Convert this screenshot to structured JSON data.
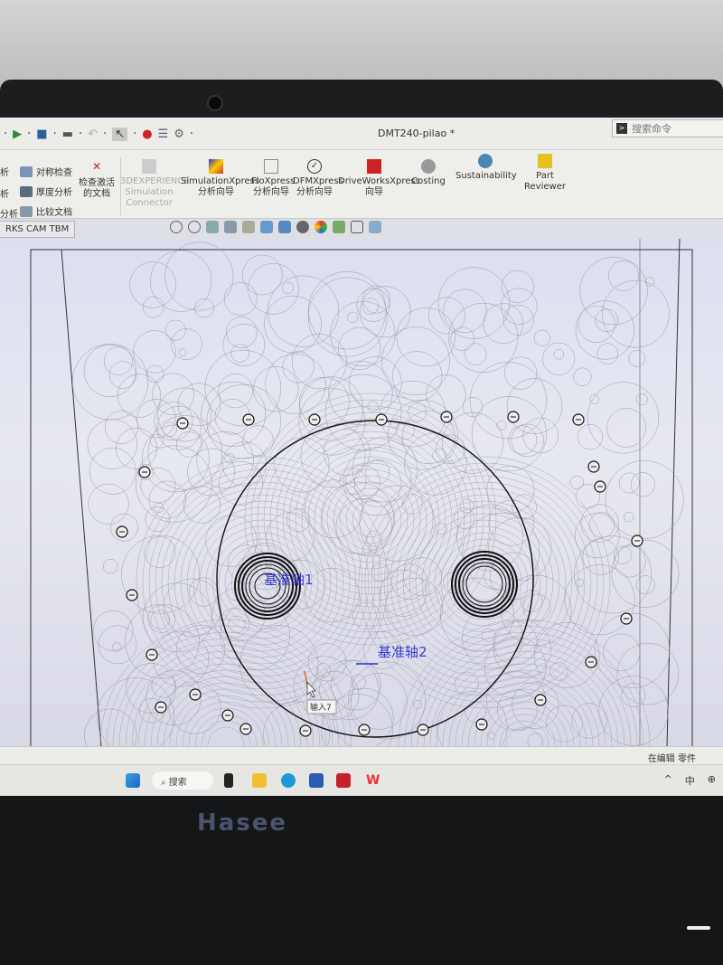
{
  "window": {
    "title": "DMT240-pilao *",
    "search_placeholder": "搜索命令"
  },
  "ribbon": {
    "left_cut": [
      "析",
      "析",
      "分析"
    ],
    "small": [
      "对称检查",
      "厚度分析",
      "比较文档"
    ],
    "check": "检查激活的文档",
    "buttons": [
      {
        "label": "3DEXPERIENCE Simulation Connector",
        "disabled": true
      },
      {
        "label": "SimulationXpress 分析向导"
      },
      {
        "label": "FloXpress 分析向导"
      },
      {
        "label": "DFMXpress 分析向导"
      },
      {
        "label": "DriveWorksXpress 向导"
      },
      {
        "label": "Costing"
      },
      {
        "label": "Sustainability"
      },
      {
        "label": "Part Reviewer"
      }
    ]
  },
  "tab": "RKS CAM TBM",
  "canvas": {
    "axis1": "基准轴1",
    "axis2": "基准轴2",
    "tooltip": "输入7"
  },
  "status": "在编辑 零件",
  "taskbar": {
    "search": "搜索",
    "tray_ime": "中",
    "tray_up": "^"
  },
  "brand": "Hasee",
  "colors": {
    "axis_label": "#3a3ad0",
    "solidworks": "#c8202a",
    "wps": "#e33"
  }
}
